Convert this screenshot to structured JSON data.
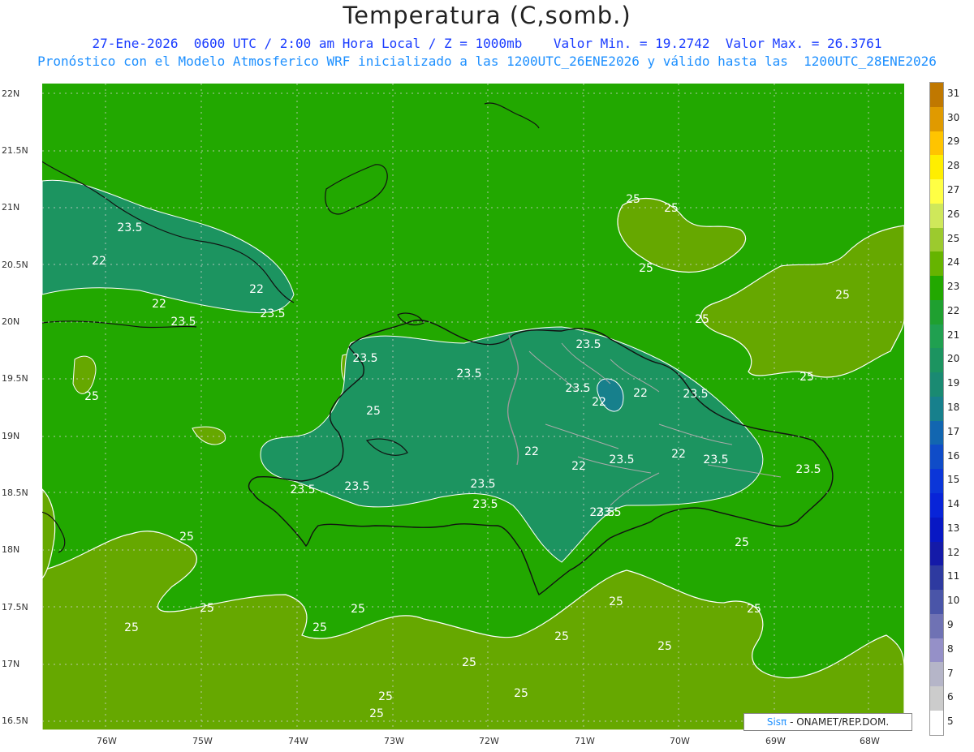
{
  "header": {
    "title": "Temperatura (C,somb.)",
    "line1": "27-Ene-2026  0600 UTC / 2:00 am Hora Local / Z = 1000mb    Valor Min. = 19.2742  Valor Max. = 26.3761",
    "line2": "Pronóstico con el Modelo Atmosferico WRF inicializado a las 1200UTC_26ENE2026 y válido hasta las  1200UTC_28ENE2026"
  },
  "axes": {
    "lat_labels": [
      "22N",
      "21.5N",
      "21N",
      "20.5N",
      "20N",
      "19.5N",
      "19N",
      "18.5N",
      "18N",
      "17.5N",
      "17N",
      "16.5N"
    ],
    "lon_labels": [
      "76W",
      "75W",
      "74W",
      "73W",
      "72W",
      "71W",
      "70W",
      "69W",
      "68W"
    ]
  },
  "contour_labels": [
    {
      "text": "25"
    },
    {
      "text": "25"
    },
    {
      "text": "25"
    },
    {
      "text": "25"
    },
    {
      "text": "25"
    },
    {
      "text": "25"
    },
    {
      "text": "25"
    },
    {
      "text": "25"
    },
    {
      "text": "25"
    },
    {
      "text": "25"
    },
    {
      "text": "25"
    },
    {
      "text": "25"
    },
    {
      "text": "25"
    },
    {
      "text": "25"
    },
    {
      "text": "25"
    },
    {
      "text": "25"
    },
    {
      "text": "25"
    },
    {
      "text": "25"
    },
    {
      "text": "25"
    },
    {
      "text": "25"
    },
    {
      "text": "25"
    },
    {
      "text": "25"
    },
    {
      "text": "23.5"
    },
    {
      "text": "23.5"
    },
    {
      "text": "23.5"
    },
    {
      "text": "23.5"
    },
    {
      "text": "23.5"
    },
    {
      "text": "23.5"
    },
    {
      "text": "23.5"
    },
    {
      "text": "23.5"
    },
    {
      "text": "23.5"
    },
    {
      "text": "23.5"
    },
    {
      "text": "23.5"
    },
    {
      "text": "23.5"
    },
    {
      "text": "23.5"
    },
    {
      "text": "23.5"
    },
    {
      "text": "23.5"
    },
    {
      "text": "23.5"
    },
    {
      "text": "23.5"
    },
    {
      "text": "22"
    },
    {
      "text": "22"
    },
    {
      "text": "22"
    },
    {
      "text": "22"
    },
    {
      "text": "22"
    },
    {
      "text": "22"
    },
    {
      "text": "22"
    },
    {
      "text": "22"
    }
  ],
  "colorbar": {
    "levels": [
      "31",
      "30",
      "29",
      "28",
      "27",
      "26",
      "25",
      "24",
      "23",
      "22",
      "21",
      "20",
      "19",
      "18",
      "17",
      "16",
      "15",
      "14",
      "13",
      "12",
      "11",
      "10",
      "9",
      "8",
      "7",
      "6",
      "5"
    ],
    "colors": [
      "#c07800",
      "#e09a00",
      "#ffc400",
      "#ffee00",
      "#ffff44",
      "#cfe85a",
      "#9cca2e",
      "#66b400",
      "#22a800",
      "#1fa030",
      "#20a050",
      "#1c9460",
      "#1a8a72",
      "#17808c",
      "#1266b0",
      "#0f4cc8",
      "#0b36d8",
      "#0824d8",
      "#0818c4",
      "#141aa8",
      "#2e3aa0",
      "#4a55a8",
      "#6f72b4",
      "#9590c8",
      "#b5b5c8",
      "#cccccc",
      "#ffffff"
    ]
  },
  "map_colors": {
    "sea_dominant": "#22a800",
    "warm_25": "#66a800",
    "cool_22": "#1c9460",
    "cold_min": "#17808c",
    "coast": "#111111",
    "border": "#999999",
    "contour": "#ffffff"
  },
  "credit": {
    "sis": "Sisπ",
    "rest": " - ONAMET/REP.DOM."
  }
}
